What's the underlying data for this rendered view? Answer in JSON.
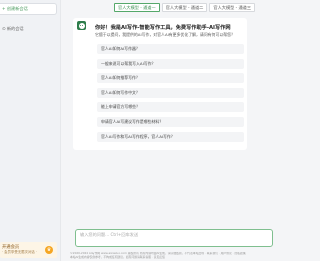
{
  "sidebar": {
    "new_chat_label": "+ 创建新会话",
    "chat_entry_label": "⊙ 新的会话",
    "vip": {
      "title": "开通会员",
      "subtitle": "· 会员享受无限次对话 ·",
      "icon": "crown-icon"
    }
  },
  "tabs": [
    {
      "label": "官人大模型 - 通道一",
      "active": true
    },
    {
      "label": "官人大模型 - 通道二",
      "active": false
    },
    {
      "label": "官人大模型 - 通道三",
      "active": false
    }
  ],
  "chat": {
    "avatar_icon": "bot-avatar-icon",
    "greeting_title": "你好！我是AI写作-智能写作工具，免费写作助手-AI写作网",
    "greeting_sub": "它擅于以提问，我提供的AI写作，对官人AI有更多优化了解，请问有何可以帮您？",
    "suggestions": [
      "官人AI如何AI写作器？",
      "一般来说可以帮我写入AI写作？",
      "官人AI如何推荐写作？",
      "官人AI如何写作中文？",
      "能上申请官方写哪些？",
      "申请官人AI写建议写作是哪些材料？",
      "官人AI写作和写AI写作程序，官人AI写作？"
    ]
  },
  "input": {
    "placeholder": "输入您的问题... Ctrl+回车发送",
    "value": ""
  },
  "footer": {
    "line1": "©2020-2024 AI写作网 www.aixiezuo.com 版权所有 所有内容均由AI生成，请仔细甄别，不代表本站立场 · 联系我们 · 用户协议 · 隐私政策",
    "line2": "本站AI生成内容仅供参考，不构成任何建议。如有问题请联系客服 · 意见反馈"
  },
  "colors": {
    "accent": "#55a86a",
    "sidebar_bg": "#f0f2f5",
    "vip_bg": "#fdf5e6"
  }
}
